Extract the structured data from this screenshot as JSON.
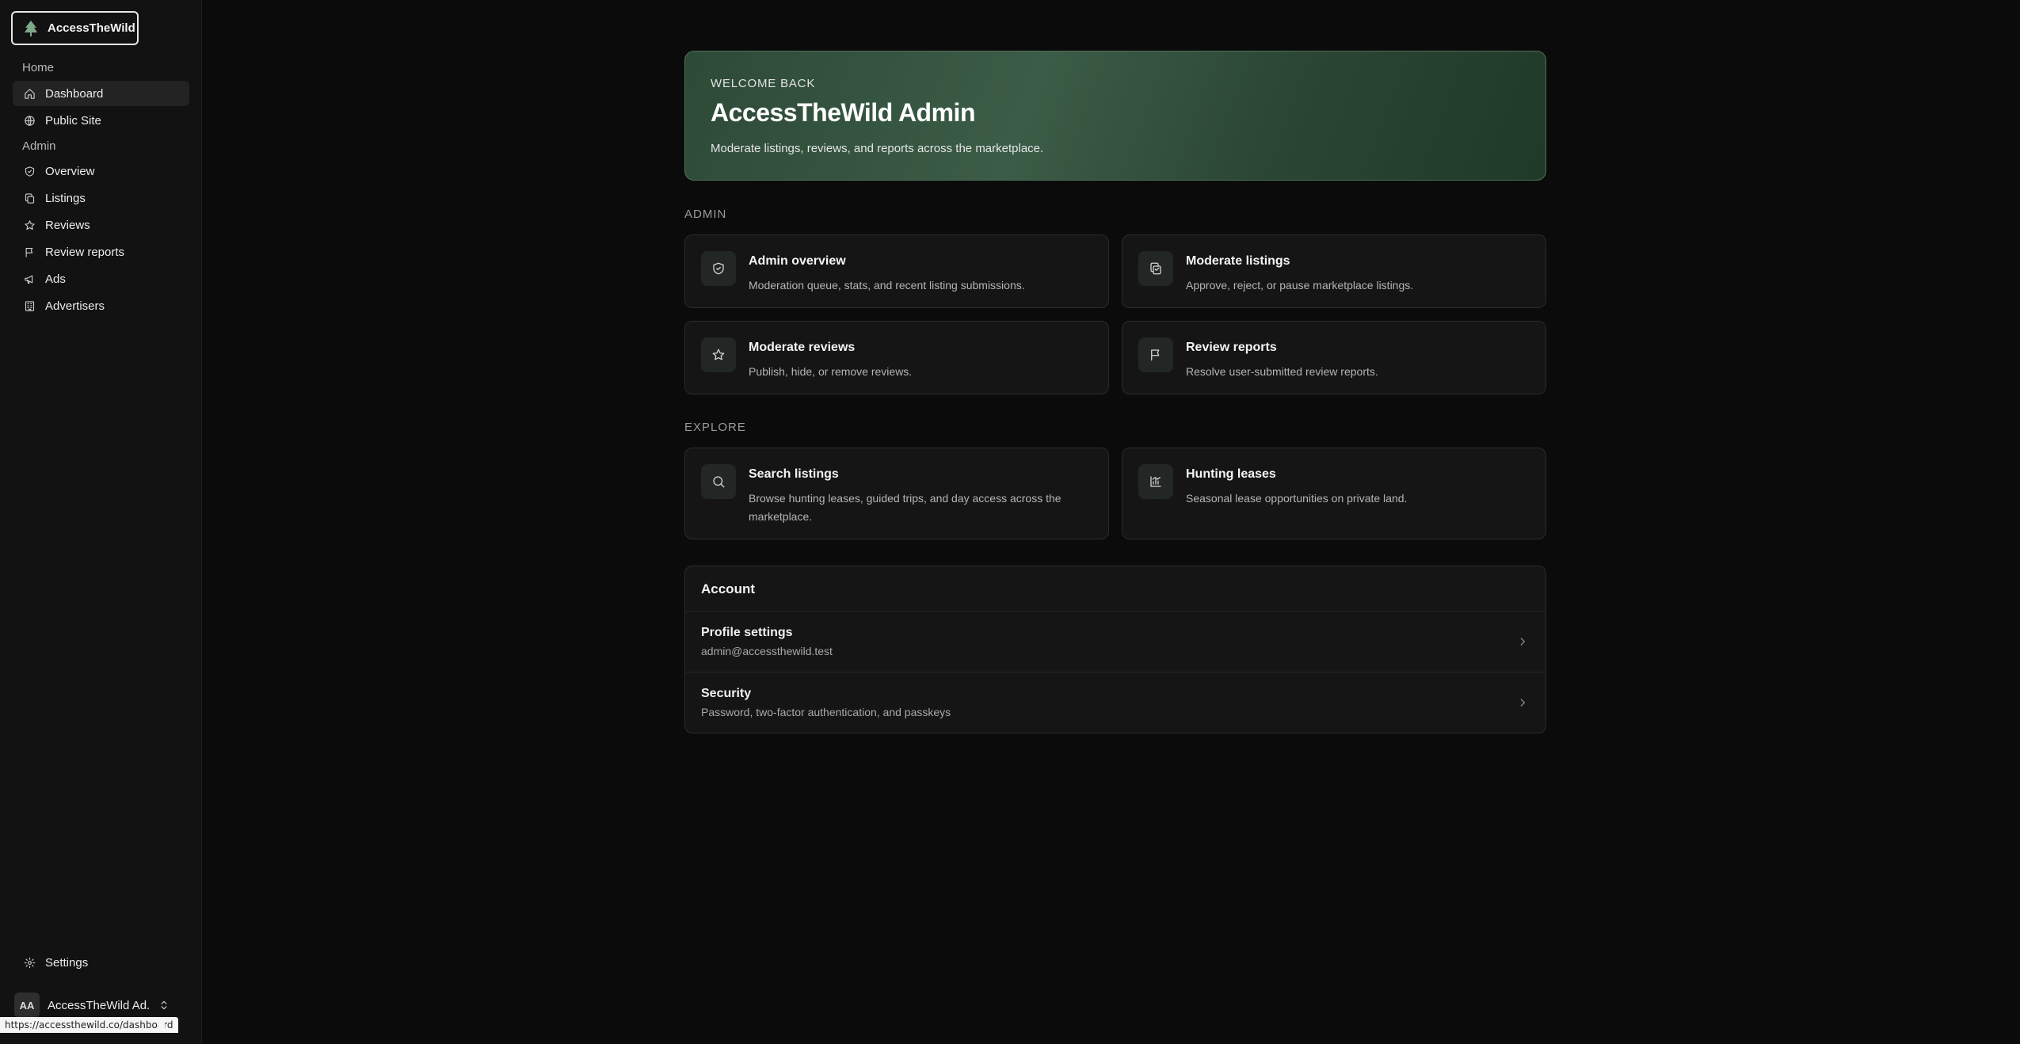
{
  "brand": {
    "name": "AccessTheWild",
    "logo_icon": "pine-tree-icon"
  },
  "sidebar": {
    "groups": [
      {
        "label": "Home"
      },
      {
        "label": "Admin"
      }
    ],
    "home_items": [
      {
        "label": "Dashboard",
        "icon": "home-icon",
        "active": true
      },
      {
        "label": "Public Site",
        "icon": "globe-icon"
      }
    ],
    "admin_items": [
      {
        "label": "Overview",
        "icon": "shield-icon"
      },
      {
        "label": "Listings",
        "icon": "copy-icon"
      },
      {
        "label": "Reviews",
        "icon": "star-icon"
      },
      {
        "label": "Review reports",
        "icon": "flag-icon"
      },
      {
        "label": "Ads",
        "icon": "megaphone-icon"
      },
      {
        "label": "Advertisers",
        "icon": "building-icon"
      }
    ],
    "settings_label": "Settings",
    "user": {
      "initials": "AA",
      "name": "AccessTheWild Ad..."
    }
  },
  "status_bar": {
    "url": "https://accessthewild.co/dashboard"
  },
  "hero": {
    "eyebrow": "WELCOME BACK",
    "title": "AccessTheWild Admin",
    "subtitle": "Moderate listings, reviews, and reports across the marketplace."
  },
  "admin_section": {
    "label": "ADMIN",
    "cards": [
      {
        "title": "Admin overview",
        "desc": "Moderation queue, stats, and recent listing submissions.",
        "icon": "shield-check-icon"
      },
      {
        "title": "Moderate listings",
        "desc": "Approve, reject, or pause marketplace listings.",
        "icon": "clipboard-icon"
      },
      {
        "title": "Moderate reviews",
        "desc": "Publish, hide, or remove reviews.",
        "icon": "star-icon"
      },
      {
        "title": "Review reports",
        "desc": "Resolve user-submitted review reports.",
        "icon": "flag-icon"
      }
    ]
  },
  "explore_section": {
    "label": "EXPLORE",
    "cards": [
      {
        "title": "Search listings",
        "desc": "Browse hunting leases, guided trips, and day access across the marketplace.",
        "icon": "search-icon"
      },
      {
        "title": "Hunting leases",
        "desc": "Seasonal lease opportunities on private land.",
        "icon": "map-chart-icon"
      }
    ]
  },
  "account": {
    "title": "Account",
    "rows": [
      {
        "title": "Profile settings",
        "sub": "admin@accessthewild.test"
      },
      {
        "title": "Security",
        "sub": "Password, two-factor authentication, and passkeys"
      }
    ]
  }
}
